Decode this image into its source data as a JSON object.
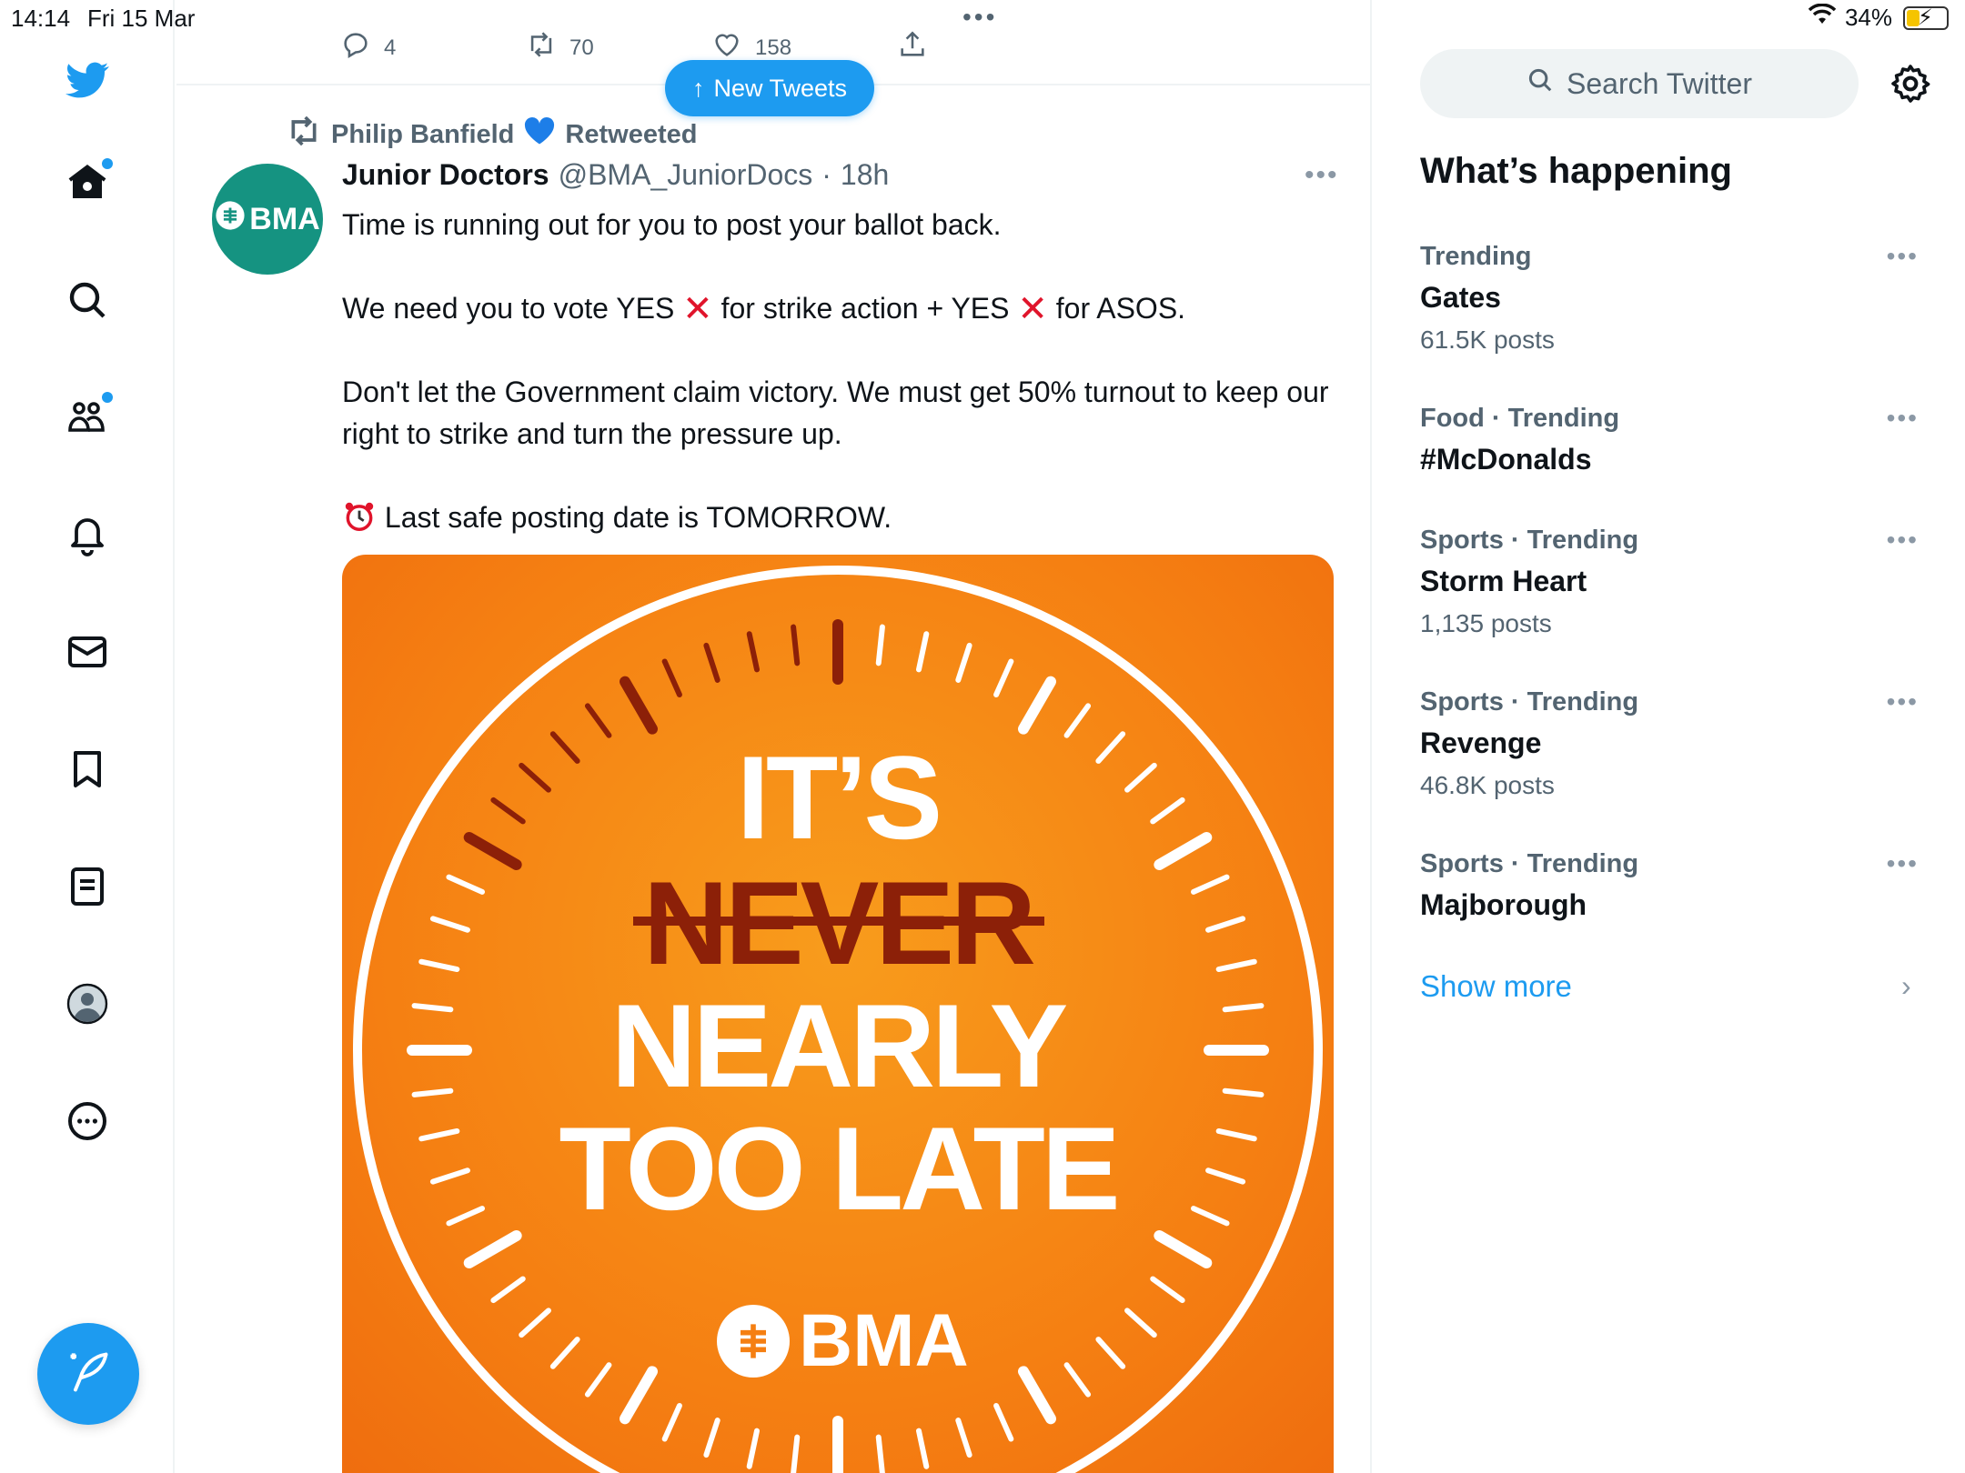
{
  "status_bar": {
    "time": "14:14",
    "date": "Fri 15 Mar",
    "battery": "34%",
    "battery_level": 0.34,
    "dots": "•••"
  },
  "prev_tweet_actions": {
    "replies": "4",
    "retweets": "70",
    "likes": "158"
  },
  "new_tweets_label": "New Tweets",
  "tweet": {
    "retweeter": "Philip Banfield",
    "retweeted_label": "Retweeted",
    "avatar_text": "BMA",
    "author_name": "Junior Doctors",
    "author_handle": "@BMA_JuniorDocs",
    "separator": "·",
    "time": "18h",
    "line1": "Time is running out for you to post your ballot back.",
    "line2a": "We need you to vote YES",
    "line2b": "for strike action + YES",
    "line2c": "for ASOS.",
    "line3": "Don't let the Government claim victory. We must get 50% turnout to keep our right to strike and turn the pressure up.",
    "line4": "Last safe posting date is TOMORROW.",
    "xmark": "❌",
    "alarm_icon": "⏰",
    "poster": {
      "line1": "IT’S",
      "line2": "NEVER",
      "line3": "NEARLY",
      "line4": "TOO LATE",
      "logo_text": "BMA",
      "colors": {
        "orange": "#f57f12",
        "dark_red": "#8c2008"
      }
    }
  },
  "search": {
    "placeholder": "Search Twitter"
  },
  "whats_happening": "What’s happening",
  "trends": [
    {
      "meta": "Trending",
      "name": "Gates",
      "count": "61.5K posts"
    },
    {
      "meta": "Food · Trending",
      "name": "#McDonalds",
      "count": ""
    },
    {
      "meta": "Sports · Trending",
      "name": "Storm Heart",
      "count": "1,135 posts"
    },
    {
      "meta": "Sports · Trending",
      "name": "Revenge",
      "count": "46.8K posts"
    },
    {
      "meta": "Sports · Trending",
      "name": "Majborough",
      "count": ""
    }
  ],
  "show_more": "Show more",
  "colors": {
    "accent": "#1d9bf0",
    "bma_teal": "#159381",
    "text": "#0f1419",
    "muted": "#536471"
  }
}
